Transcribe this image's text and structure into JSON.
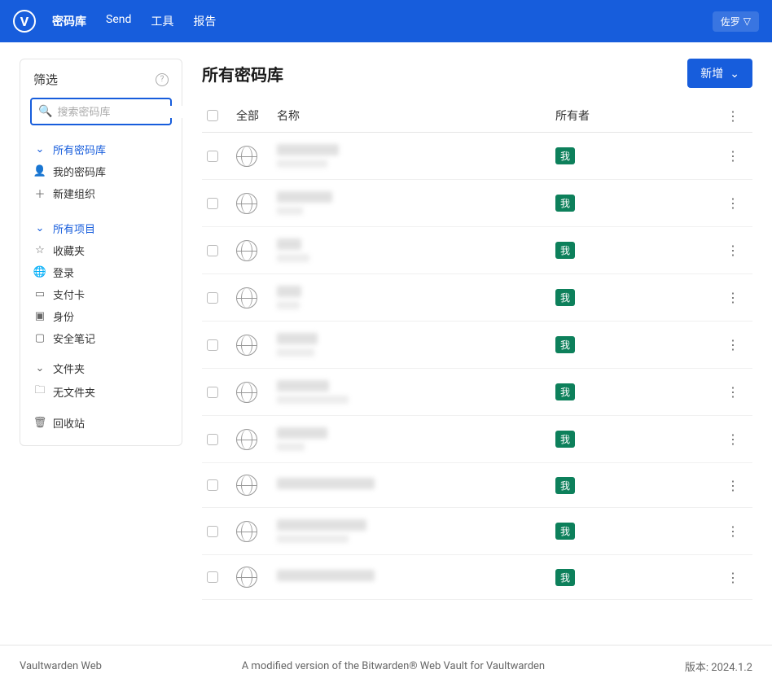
{
  "nav": {
    "logo": "V",
    "items": [
      "密码库",
      "Send",
      "工具",
      "报告"
    ],
    "user_label": "佐罗"
  },
  "sidebar": {
    "filter_title": "筛选",
    "search_placeholder": "搜索密码库",
    "groups": {
      "vaults": {
        "all": "所有密码库",
        "mine": "我的密码库",
        "new_org": "新建组织"
      },
      "items": {
        "all": "所有项目",
        "favorites": "收藏夹",
        "login": "登录",
        "card": "支付卡",
        "identity": "身份",
        "note": "安全笔记"
      },
      "folders": {
        "title": "文件夹",
        "none": "无文件夹"
      },
      "trash": "回收站"
    }
  },
  "content": {
    "title": "所有密码库",
    "new_button": "新增",
    "columns": {
      "all": "全部",
      "name": "名称",
      "owner": "所有者"
    },
    "owner_badge": "我",
    "rows": [
      {
        "name_w": 76,
        "sub_w": 62
      },
      {
        "name_w": 68,
        "sub_w": 32
      },
      {
        "name_w": 30,
        "sub_w": 40
      },
      {
        "name_w": 30,
        "sub_w": 28
      },
      {
        "name_w": 50,
        "sub_w": 46
      },
      {
        "name_w": 64,
        "sub_w": 88
      },
      {
        "name_w": 62,
        "sub_w": 34
      },
      {
        "name_w": 120,
        "sub_w": 0
      },
      {
        "name_w": 110,
        "sub_w": 88
      },
      {
        "name_w": 120,
        "sub_w": 0
      }
    ]
  },
  "footer": {
    "left": "Vaultwarden Web",
    "center": "A modified version of the Bitwarden® Web Vault for Vaultwarden",
    "right": "版本: 2024.1.2"
  }
}
